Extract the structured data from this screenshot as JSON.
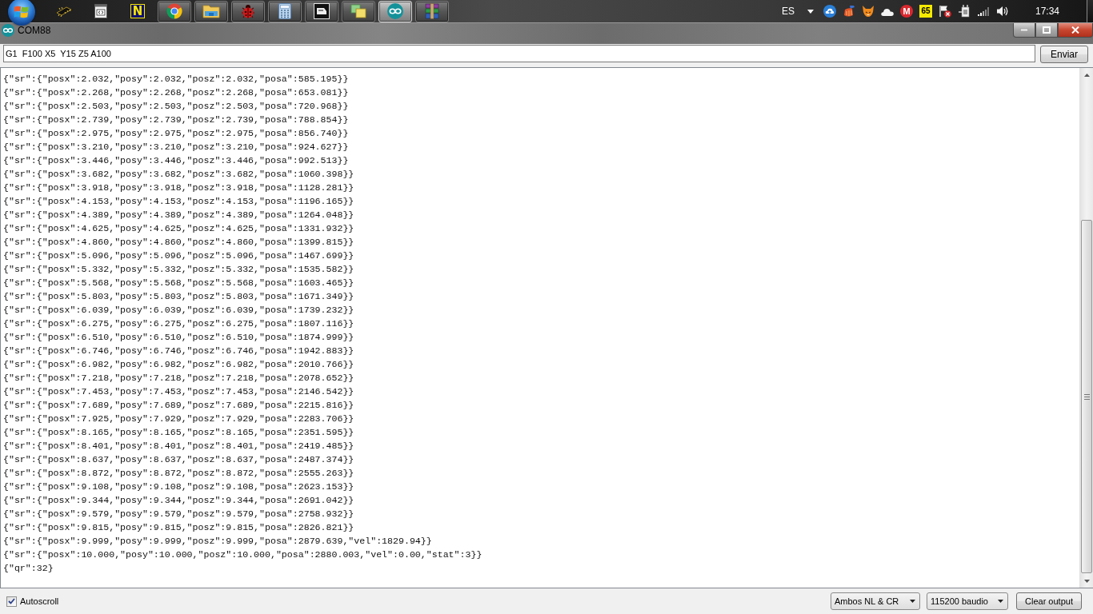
{
  "taskbar": {
    "apps": [
      {
        "kind": "chip",
        "running": false,
        "selected": false
      },
      {
        "kind": "code-window",
        "running": false,
        "selected": false
      },
      {
        "kind": "letter",
        "text": "N",
        "running": false,
        "selected": false
      },
      {
        "kind": "browser",
        "running": true,
        "selected": false
      },
      {
        "kind": "folder",
        "running": true,
        "selected": false
      },
      {
        "kind": "ladybug",
        "running": true,
        "selected": false
      },
      {
        "kind": "calculator",
        "running": true,
        "selected": false
      },
      {
        "kind": "tile",
        "running": true,
        "selected": false
      },
      {
        "kind": "squares",
        "running": true,
        "selected": false
      },
      {
        "kind": "infinity",
        "running": true,
        "selected": true
      },
      {
        "kind": "books",
        "running": true,
        "selected": false
      }
    ],
    "language": "ES",
    "tray_icons": [
      {
        "kind": "cloud-upload"
      },
      {
        "kind": "broom"
      },
      {
        "kind": "fox"
      },
      {
        "kind": "cloud"
      },
      {
        "kind": "round-badge",
        "text": "M"
      },
      {
        "kind": "square-badge",
        "text": "65"
      },
      {
        "kind": "flag"
      },
      {
        "kind": "plug"
      },
      {
        "kind": "signal"
      },
      {
        "kind": "speaker"
      }
    ],
    "clock": "17:34"
  },
  "window": {
    "title": "COM88"
  },
  "command": {
    "value": "G1  F100 X5  Y15 Z5 A100"
  },
  "send_button": "Enviar",
  "output_lines": [
    "{\"sr\":{\"posx\":2.032,\"posy\":2.032,\"posz\":2.032,\"posa\":585.195}}",
    "{\"sr\":{\"posx\":2.268,\"posy\":2.268,\"posz\":2.268,\"posa\":653.081}}",
    "{\"sr\":{\"posx\":2.503,\"posy\":2.503,\"posz\":2.503,\"posa\":720.968}}",
    "{\"sr\":{\"posx\":2.739,\"posy\":2.739,\"posz\":2.739,\"posa\":788.854}}",
    "{\"sr\":{\"posx\":2.975,\"posy\":2.975,\"posz\":2.975,\"posa\":856.740}}",
    "{\"sr\":{\"posx\":3.210,\"posy\":3.210,\"posz\":3.210,\"posa\":924.627}}",
    "{\"sr\":{\"posx\":3.446,\"posy\":3.446,\"posz\":3.446,\"posa\":992.513}}",
    "{\"sr\":{\"posx\":3.682,\"posy\":3.682,\"posz\":3.682,\"posa\":1060.398}}",
    "{\"sr\":{\"posx\":3.918,\"posy\":3.918,\"posz\":3.918,\"posa\":1128.281}}",
    "{\"sr\":{\"posx\":4.153,\"posy\":4.153,\"posz\":4.153,\"posa\":1196.165}}",
    "{\"sr\":{\"posx\":4.389,\"posy\":4.389,\"posz\":4.389,\"posa\":1264.048}}",
    "{\"sr\":{\"posx\":4.625,\"posy\":4.625,\"posz\":4.625,\"posa\":1331.932}}",
    "{\"sr\":{\"posx\":4.860,\"posy\":4.860,\"posz\":4.860,\"posa\":1399.815}}",
    "{\"sr\":{\"posx\":5.096,\"posy\":5.096,\"posz\":5.096,\"posa\":1467.699}}",
    "{\"sr\":{\"posx\":5.332,\"posy\":5.332,\"posz\":5.332,\"posa\":1535.582}}",
    "{\"sr\":{\"posx\":5.568,\"posy\":5.568,\"posz\":5.568,\"posa\":1603.465}}",
    "{\"sr\":{\"posx\":5.803,\"posy\":5.803,\"posz\":5.803,\"posa\":1671.349}}",
    "{\"sr\":{\"posx\":6.039,\"posy\":6.039,\"posz\":6.039,\"posa\":1739.232}}",
    "{\"sr\":{\"posx\":6.275,\"posy\":6.275,\"posz\":6.275,\"posa\":1807.116}}",
    "{\"sr\":{\"posx\":6.510,\"posy\":6.510,\"posz\":6.510,\"posa\":1874.999}}",
    "{\"sr\":{\"posx\":6.746,\"posy\":6.746,\"posz\":6.746,\"posa\":1942.883}}",
    "{\"sr\":{\"posx\":6.982,\"posy\":6.982,\"posz\":6.982,\"posa\":2010.766}}",
    "{\"sr\":{\"posx\":7.218,\"posy\":7.218,\"posz\":7.218,\"posa\":2078.652}}",
    "{\"sr\":{\"posx\":7.453,\"posy\":7.453,\"posz\":7.453,\"posa\":2146.542}}",
    "{\"sr\":{\"posx\":7.689,\"posy\":7.689,\"posz\":7.689,\"posa\":2215.816}}",
    "{\"sr\":{\"posx\":7.925,\"posy\":7.929,\"posz\":7.929,\"posa\":2283.706}}",
    "{\"sr\":{\"posx\":8.165,\"posy\":8.165,\"posz\":8.165,\"posa\":2351.595}}",
    "{\"sr\":{\"posx\":8.401,\"posy\":8.401,\"posz\":8.401,\"posa\":2419.485}}",
    "{\"sr\":{\"posx\":8.637,\"posy\":8.637,\"posz\":8.637,\"posa\":2487.374}}",
    "{\"sr\":{\"posx\":8.872,\"posy\":8.872,\"posz\":8.872,\"posa\":2555.263}}",
    "{\"sr\":{\"posx\":9.108,\"posy\":9.108,\"posz\":9.108,\"posa\":2623.153}}",
    "{\"sr\":{\"posx\":9.344,\"posy\":9.344,\"posz\":9.344,\"posa\":2691.042}}",
    "{\"sr\":{\"posx\":9.579,\"posy\":9.579,\"posz\":9.579,\"posa\":2758.932}}",
    "{\"sr\":{\"posx\":9.815,\"posy\":9.815,\"posz\":9.815,\"posa\":2826.821}}",
    "{\"sr\":{\"posx\":9.999,\"posy\":9.999,\"posz\":9.999,\"posa\":2879.639,\"vel\":1829.94}}",
    "{\"sr\":{\"posx\":10.000,\"posy\":10.000,\"posz\":10.000,\"posa\":2880.003,\"vel\":0.00,\"stat\":3}}",
    "{\"qr\":32}"
  ],
  "autoscroll": {
    "label": "Autoscroll",
    "checked": true
  },
  "line_ending": "Ambos NL & CR",
  "baud_rate": "115200 baudio",
  "clear_button": "Clear output"
}
